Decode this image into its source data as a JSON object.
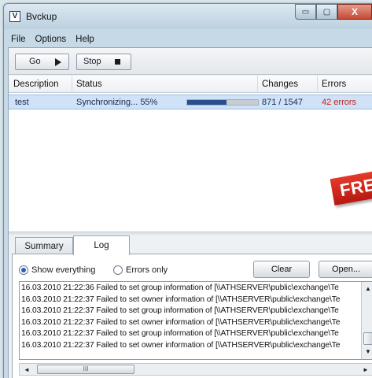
{
  "window": {
    "title": "Bvckup",
    "icon": "V",
    "controls": {
      "minimize": "▭",
      "maximize": "▢",
      "close": "X"
    }
  },
  "menu": {
    "items": [
      "File",
      "Options",
      "Help"
    ]
  },
  "toolbar": {
    "go_label": "Go",
    "stop_label": "Stop"
  },
  "table": {
    "headers": {
      "description": "Description",
      "status": "Status",
      "changes": "Changes",
      "errors": "Errors"
    },
    "rows": [
      {
        "description": "test",
        "status": "Synchronizing... 55%",
        "progress": 0.55,
        "changes": "871 / 1547",
        "errors": "42 errors"
      }
    ]
  },
  "banner": {
    "text": "FRE"
  },
  "tabs": {
    "summary": "Summary",
    "log": "Log"
  },
  "log_panel": {
    "filter_all": "Show everything",
    "filter_errors": "Errors only",
    "clear_label": "Clear",
    "open_label": "Open...",
    "scroll_grip": "III",
    "lines": [
      "16.03.2010  21:22:36  Failed to set group information of [\\\\ATHSERVER\\public\\exchange\\Te",
      "16.03.2010  21:22:37  Failed to set owner information of [\\\\ATHSERVER\\public\\exchange\\Te",
      "16.03.2010  21:22:37  Failed to set group information of [\\\\ATHSERVER\\public\\exchange\\Te",
      "16.03.2010  21:22:37  Failed to set owner information of [\\\\ATHSERVER\\public\\exchange\\Te",
      "16.03.2010  21:22:37  Failed to set group information of [\\\\ATHSERVER\\public\\exchange\\Te",
      "16.03.2010  21:22:37  Failed to set owner information of [\\\\ATHSERVER\\public\\exchange\\Te"
    ]
  },
  "colors": {
    "progress": "#28508d",
    "errors": "#c4241b",
    "selection": "#cfe2f8",
    "banner": "#d6261b"
  }
}
